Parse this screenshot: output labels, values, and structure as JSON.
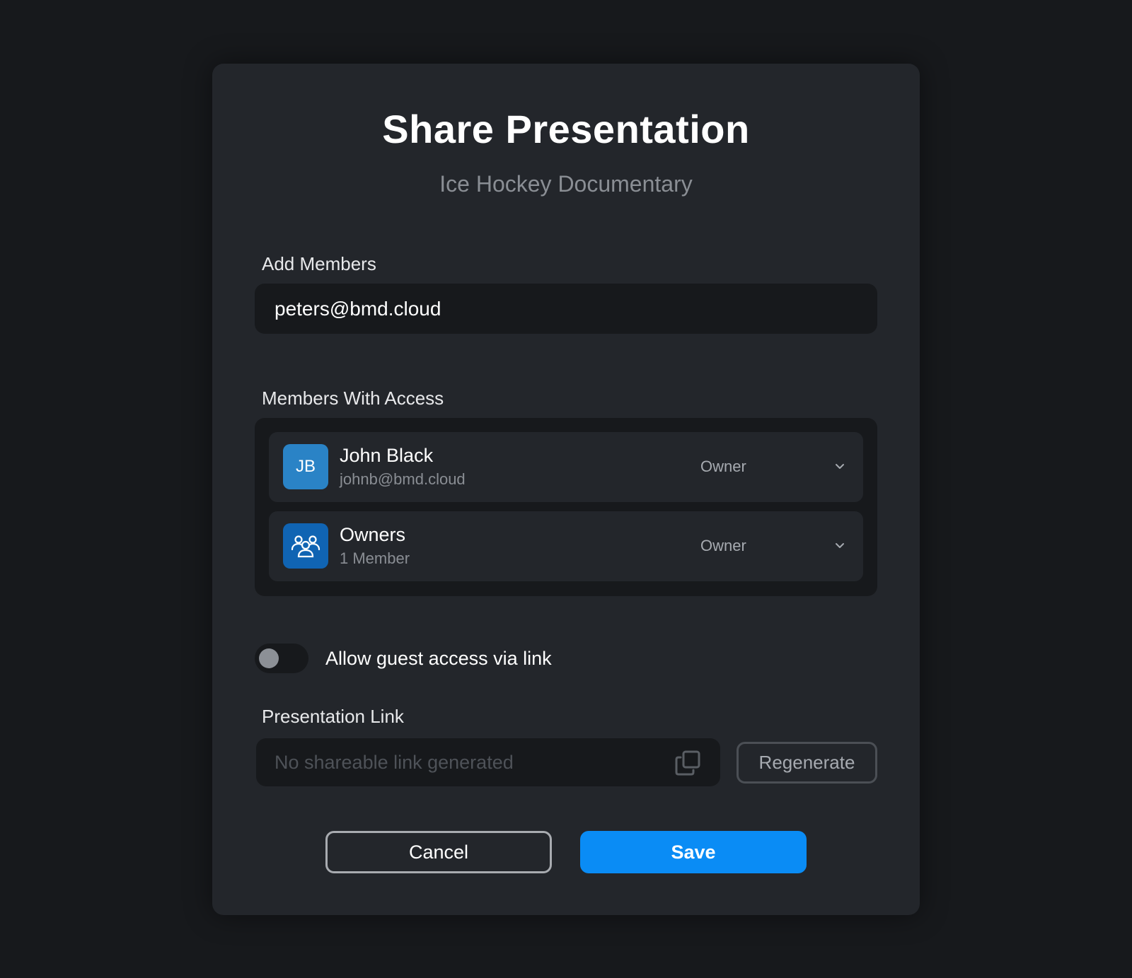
{
  "dialog": {
    "title": "Share Presentation",
    "subtitle": "Ice Hockey Documentary"
  },
  "add_members": {
    "label": "Add Members",
    "value": "peters@bmd.cloud"
  },
  "members_with_access": {
    "label": "Members With Access",
    "items": [
      {
        "initials": "JB",
        "name": "John Black",
        "detail": "johnb@bmd.cloud",
        "role": "Owner",
        "avatar_color": "#2a83c6",
        "avatar_icon": "initials"
      },
      {
        "initials": "",
        "name": "Owners",
        "detail": "1 Member",
        "role": "Owner",
        "avatar_color": "#1064b3",
        "avatar_icon": "user-group-icon"
      }
    ]
  },
  "guest_access": {
    "label": "Allow guest access via link",
    "enabled": false
  },
  "presentation_link": {
    "label": "Presentation Link",
    "placeholder": "No shareable link generated",
    "value": "",
    "copy_icon": "copy-icon",
    "regenerate_label": "Regenerate"
  },
  "actions": {
    "cancel_label": "Cancel",
    "save_label": "Save"
  },
  "colors": {
    "background": "#17191c",
    "panel": "#23262b",
    "accent": "#0a8cf5"
  }
}
